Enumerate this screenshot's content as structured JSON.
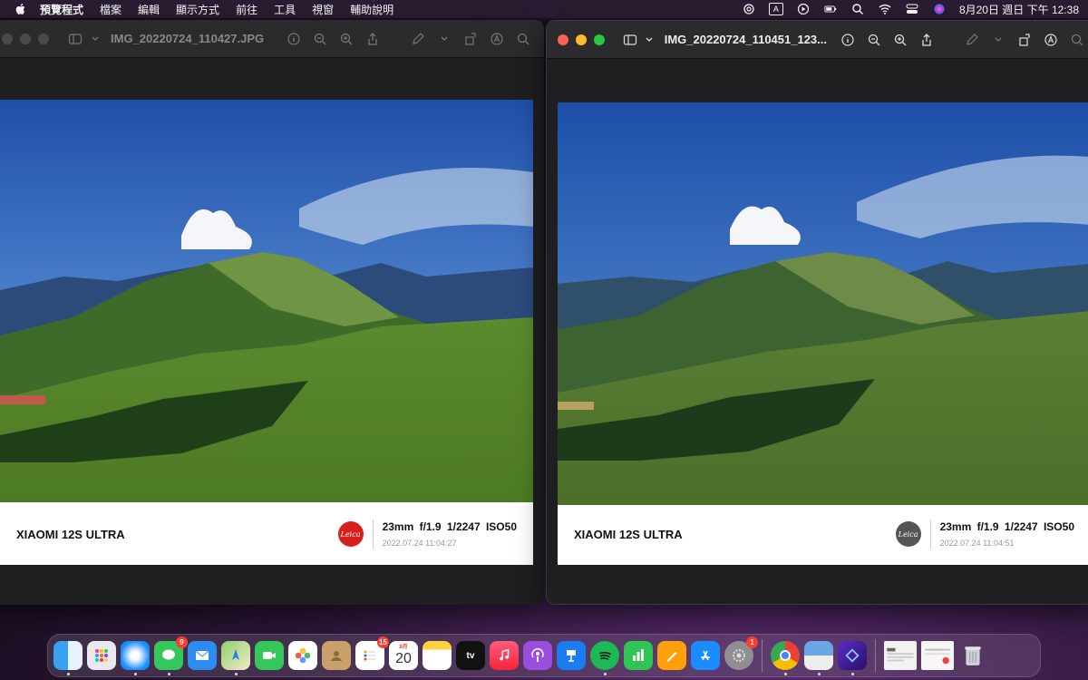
{
  "menubar": {
    "app_name": "預覽程式",
    "items": [
      "檔案",
      "編輯",
      "顯示方式",
      "前往",
      "工具",
      "視窗",
      "輔助說明"
    ],
    "input_source": "A",
    "clock": "8月20日 週日 下午 12:38"
  },
  "windows": [
    {
      "title": "IMG_20220724_110427.JPG",
      "caption": {
        "model": "XIAOMI 12S ULTRA",
        "params": "23mm f/1.9 1/2247 ISO50",
        "date": "2022.07.24 11:04:27",
        "logo": "Leica"
      }
    },
    {
      "title": "IMG_20220724_110451_123...",
      "caption": {
        "model": "XIAOMI 12S ULTRA",
        "params": "23mm f/1.9 1/2247 ISO50",
        "date": "2022.07.24 11:04:51",
        "logo": "Leica"
      }
    }
  ],
  "dock": {
    "badges": {
      "messages": "9",
      "reminders": "15",
      "system_settings": "1"
    },
    "calendar": {
      "month": "8月",
      "day": "20"
    },
    "tv_label": "tv"
  },
  "colors": {
    "leica_red": "#d6201e",
    "leica_gray": "#555555",
    "menubar": "#2a1d33"
  }
}
